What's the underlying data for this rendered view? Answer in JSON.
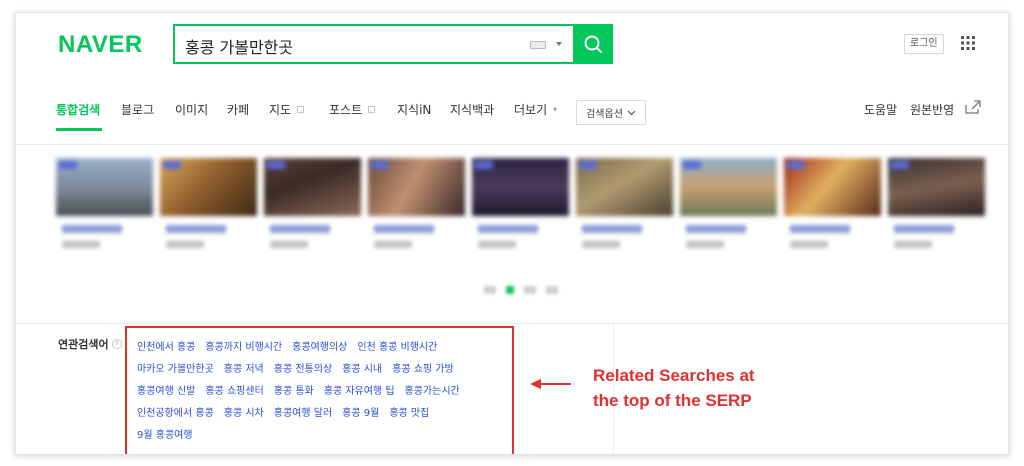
{
  "header": {
    "logo": "NAVER",
    "search_value": "홍콩 가볼만한곳",
    "login_label": "로그인"
  },
  "nav": {
    "items": [
      {
        "label": "통합검색",
        "active": true
      },
      {
        "label": "블로그"
      },
      {
        "label": "이미지"
      },
      {
        "label": "카페"
      },
      {
        "label": "지도"
      },
      {
        "label": "포스트"
      },
      {
        "label": "지식iN"
      },
      {
        "label": "지식백과"
      },
      {
        "label": "더보기"
      }
    ],
    "options_label": "검색옵션",
    "right_items": [
      "도움말",
      "원본반영"
    ]
  },
  "related": {
    "title": "연관검색어",
    "rows": [
      [
        "인천에서 홍콩",
        "홍콩까지 비행시간",
        "홍콩여행의상",
        "인천 홍콩 비행시간"
      ],
      [
        "마카오 가볼만한곳",
        "홍콩 저녁",
        "홍콩 전통의상",
        "홍콩 시내",
        "홍콩 쇼핑 가방"
      ],
      [
        "홍콩여행 신발",
        "홍콩 쇼핑센터",
        "홍콩 통화",
        "홍콩 자유여행 팁",
        "홍콩가는시간"
      ],
      [
        "인천공항에서 홍콩",
        "홍콩 시차",
        "홍콩여행 달러",
        "홍콩 9월",
        "홍콩 맛집"
      ],
      [
        "9월 홍콩여행"
      ]
    ]
  },
  "annotation": {
    "line1": "Related Searches at",
    "line2": "the top of the SERP"
  },
  "colors": {
    "brand": "#03c75a",
    "link": "#2a4ed8",
    "highlight": "#e03131"
  }
}
